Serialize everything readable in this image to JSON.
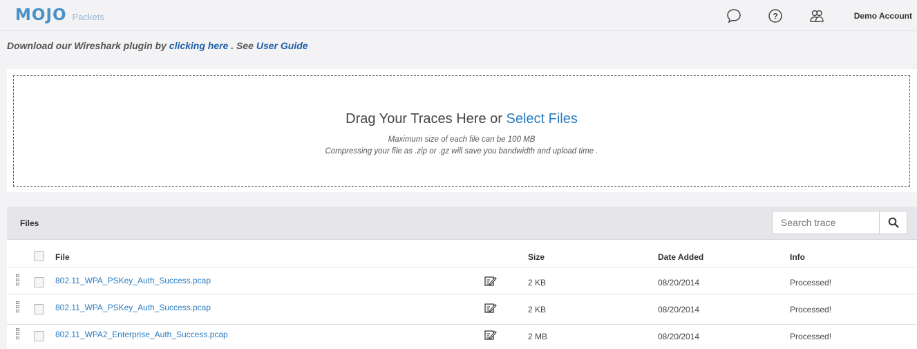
{
  "header": {
    "logo_text": "MOJO",
    "logo_sub": "Packets",
    "account": "Demo Account",
    "icons": [
      "chat-icon",
      "help-icon",
      "users-icon"
    ]
  },
  "plugin": {
    "prefix": "Download our Wireshark plugin by",
    "link1": "clicking here",
    "middle": ". See",
    "link2": "User Guide"
  },
  "dropzone": {
    "title_prefix": "Drag Your Traces Here or",
    "title_link": "Select Files",
    "note1": "Maximum size of each file can be 100 MB",
    "note2": "Compressing your file as .zip or .gz will save you bandwidth and upload time ."
  },
  "files": {
    "title": "Files",
    "search_placeholder": "Search trace",
    "columns": {
      "file": "File",
      "size": "Size",
      "date": "Date Added",
      "info": "Info"
    },
    "rows": [
      {
        "name": "802.11_WPA_PSKey_Auth_Success.pcap",
        "size": "2 KB",
        "date": "08/20/2014",
        "info": "Processed!"
      },
      {
        "name": "802.11_WPA_PSKey_Auth_Success.pcap",
        "size": "2 KB",
        "date": "08/20/2014",
        "info": "Processed!"
      },
      {
        "name": "802.11_WPA2_Enterprise_Auth_Success.pcap",
        "size": "2 MB",
        "date": "08/20/2014",
        "info": "Processed!"
      }
    ]
  }
}
